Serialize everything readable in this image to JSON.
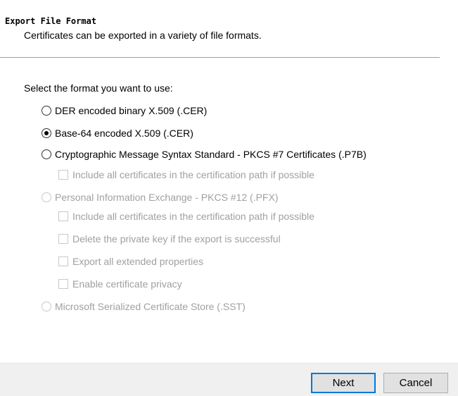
{
  "header": {
    "title": "Export File Format",
    "subtitle": "Certificates can be exported in a variety of file formats."
  },
  "prompt": "Select the format you want to use:",
  "options": [
    {
      "label": "DER encoded binary X.509 (.CER)",
      "checked": false,
      "enabled": true
    },
    {
      "label": "Base-64 encoded X.509 (.CER)",
      "checked": true,
      "enabled": true
    },
    {
      "label": "Cryptographic Message Syntax Standard - PKCS #7 Certificates (.P7B)",
      "checked": false,
      "enabled": true
    },
    {
      "label": "Personal Information Exchange - PKCS #12 (.PFX)",
      "checked": false,
      "enabled": false
    },
    {
      "label": "Microsoft Serialized Certificate Store (.SST)",
      "checked": false,
      "enabled": false
    }
  ],
  "p7b_options": [
    "Include all certificates in the certification path if possible"
  ],
  "pfx_options": [
    "Include all certificates in the certification path if possible",
    "Delete the private key if the export is successful",
    "Export all extended properties",
    "Enable certificate privacy"
  ],
  "buttons": {
    "next": "Next",
    "cancel": "Cancel"
  }
}
